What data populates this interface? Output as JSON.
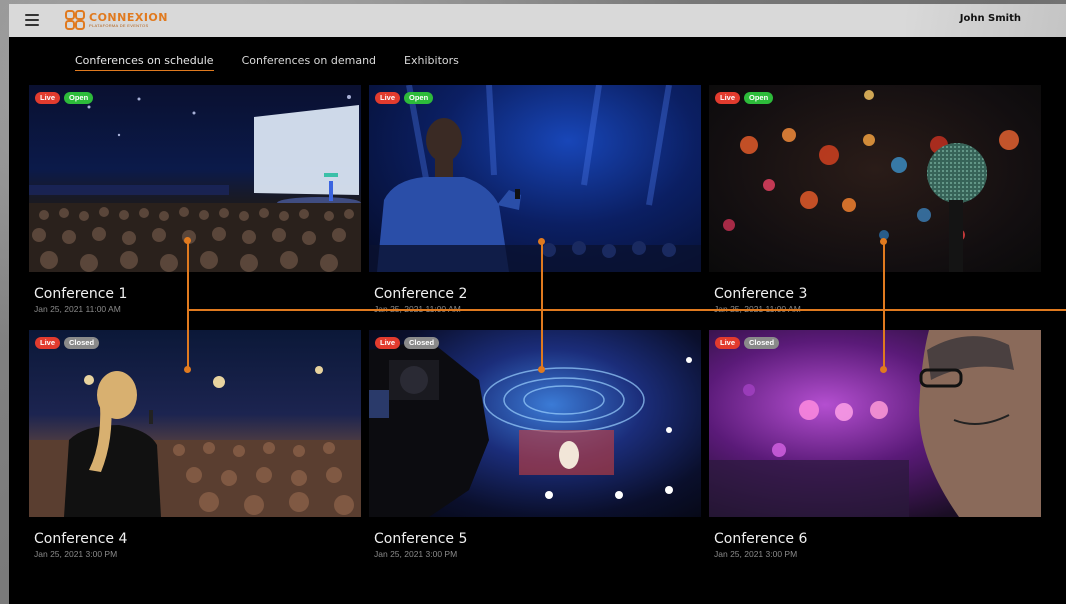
{
  "header": {
    "logo_name": "CONNEXION",
    "logo_tagline": "PLATAFORMA DE EVENTOS",
    "user_name": "John Smith"
  },
  "tabs": [
    {
      "label": "Conferences on schedule",
      "active": true
    },
    {
      "label": "Conferences on demand",
      "active": false
    },
    {
      "label": "Exhibitors",
      "active": false
    }
  ],
  "conferences": [
    {
      "title": "Conference 1",
      "date": "Jan 25, 2021 11:00 AM",
      "live_label": "Live",
      "status_label": "Open"
    },
    {
      "title": "Conference 2",
      "date": "Jan 25, 2021 11:00 AM",
      "live_label": "Live",
      "status_label": "Open"
    },
    {
      "title": "Conference 3",
      "date": "Jan 25, 2021 11:00 AM",
      "live_label": "Live",
      "status_label": "Open"
    },
    {
      "title": "Conference 4",
      "date": "Jan 25, 2021 3:00 PM",
      "live_label": "Live",
      "status_label": "Closed"
    },
    {
      "title": "Conference 5",
      "date": "Jan 25, 2021 3:00 PM",
      "live_label": "Live",
      "status_label": "Closed"
    },
    {
      "title": "Conference 6",
      "date": "Jan 25, 2021 3:00 PM",
      "live_label": "Live",
      "status_label": "Closed"
    }
  ],
  "colors": {
    "accent": "#e07a1f",
    "live": "#e23b2e",
    "open": "#2dbb3a",
    "closed": "#8a8a8a",
    "background": "#000000",
    "header": "#d9d9d9"
  },
  "icons": {
    "menu": "hamburger-icon",
    "logo": "connexion-logo"
  }
}
